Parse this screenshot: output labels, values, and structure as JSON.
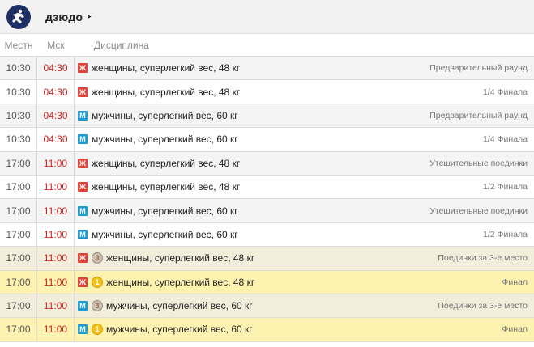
{
  "header": {
    "title": "Дзюдо",
    "caret": "▸",
    "logo_icon": "judo-sport-icon"
  },
  "columns": {
    "local": "Местн",
    "msk": "Мск",
    "discipline": "Дисциплина"
  },
  "colors": {
    "msk_time": "#d0201c",
    "women": "#e0443b",
    "men": "#1d9cd3",
    "bronze_row": "#f3eedc",
    "final_row": "#fdf2b0"
  },
  "rows": [
    {
      "local": "10:30",
      "msk": "04:30",
      "gender": "Ж",
      "discipline": "женщины, суперлегкий вес, 48 кг",
      "stage": "Предварительный раунд",
      "style": "g"
    },
    {
      "local": "10:30",
      "msk": "04:30",
      "gender": "Ж",
      "discipline": "женщины, суперлегкий вес, 48 кг",
      "stage": "1/4 Финала",
      "style": "w"
    },
    {
      "local": "10:30",
      "msk": "04:30",
      "gender": "М",
      "discipline": "мужчины, суперлегкий вес, 60 кг",
      "stage": "Предварительный раунд",
      "style": "g"
    },
    {
      "local": "10:30",
      "msk": "04:30",
      "gender": "М",
      "discipline": "мужчины, суперлегкий вес, 60 кг",
      "stage": "1/4 Финала",
      "style": "w"
    },
    {
      "local": "17:00",
      "msk": "11:00",
      "gender": "Ж",
      "discipline": "женщины, суперлегкий вес, 48 кг",
      "stage": "Утешительные поединки",
      "style": "g"
    },
    {
      "local": "17:00",
      "msk": "11:00",
      "gender": "Ж",
      "discipline": "женщины, суперлегкий вес, 48 кг",
      "stage": "1/2 Финала",
      "style": "w"
    },
    {
      "local": "17:00",
      "msk": "11:00",
      "gender": "М",
      "discipline": "мужчины, суперлегкий вес, 60 кг",
      "stage": "Утешительные поединки",
      "style": "g"
    },
    {
      "local": "17:00",
      "msk": "11:00",
      "gender": "М",
      "discipline": "мужчины, суперлегкий вес, 60 кг",
      "stage": "1/2 Финала",
      "style": "w"
    },
    {
      "local": "17:00",
      "msk": "11:00",
      "gender": "Ж",
      "medal": "bronze",
      "medal_glyph": "3",
      "discipline": "женщины, суперлегкий вес, 48 кг",
      "stage": "Поединки за 3-е место",
      "style": "b"
    },
    {
      "local": "17:00",
      "msk": "11:00",
      "gender": "Ж",
      "medal": "gold",
      "medal_glyph": "1",
      "discipline": "женщины, суперлегкий вес, 48 кг",
      "stage": "Финал",
      "style": "y"
    },
    {
      "local": "17:00",
      "msk": "11:00",
      "gender": "М",
      "medal": "bronze",
      "medal_glyph": "3",
      "discipline": "мужчины, суперлегкий вес, 60 кг",
      "stage": "Поединки за 3-е место",
      "style": "b"
    },
    {
      "local": "17:00",
      "msk": "11:00",
      "gender": "М",
      "medal": "gold",
      "medal_glyph": "1",
      "discipline": "мужчины, суперлегкий вес, 60 кг",
      "stage": "Финал",
      "style": "y"
    }
  ]
}
